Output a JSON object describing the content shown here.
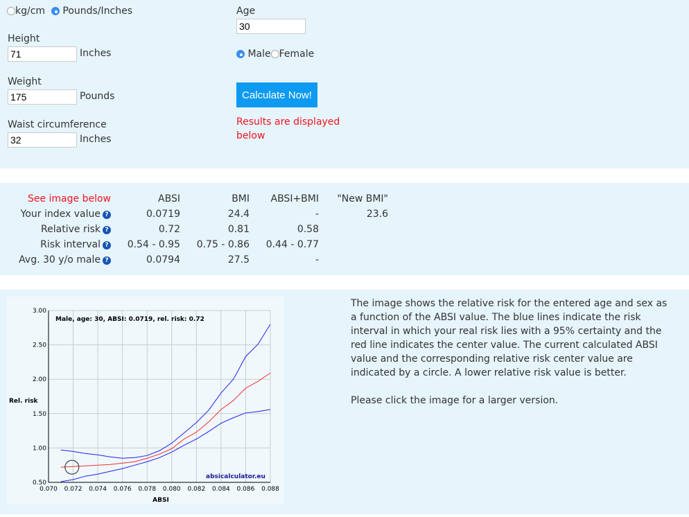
{
  "form": {
    "units": [
      {
        "label": "kg/cm",
        "selected": false
      },
      {
        "label": "Pounds/Inches",
        "selected": true
      }
    ],
    "height_label": "Height",
    "height_value": "71",
    "height_unit": "Inches",
    "weight_label": "Weight",
    "weight_value": "175",
    "weight_unit": "Pounds",
    "waist_label": "Waist circumference",
    "waist_value": "32",
    "waist_unit": "Inches",
    "age_label": "Age",
    "age_value": "30",
    "sex": [
      {
        "label": "Male",
        "selected": true
      },
      {
        "label": "Female",
        "selected": false
      }
    ],
    "calculate_label": "Calculate Now!",
    "results_note": "Results are displayed below"
  },
  "results": {
    "headers": [
      "See image below",
      "ABSI",
      "BMI",
      "ABSI+BMI",
      "\"New BMI\""
    ],
    "rows": [
      {
        "label": "Your index value",
        "values": [
          "0.0719",
          "24.4",
          "-",
          "23.6"
        ]
      },
      {
        "label": "Relative risk",
        "values": [
          "0.72",
          "0.81",
          "0.58",
          ""
        ]
      },
      {
        "label": "Risk interval",
        "values": [
          "0.54 - 0.95",
          "0.75 - 0.86",
          "0.44 - 0.77",
          ""
        ]
      },
      {
        "label": "Avg. 30 y/o male",
        "values": [
          "0.0794",
          "27.5",
          "-",
          ""
        ]
      }
    ],
    "help_icon": "?"
  },
  "description": {
    "p1": "The image shows the relative risk for the entered age and sex as a function of the ABSI value. The blue lines indicate the risk interval in which your real risk lies with a 95% certainty and the red line indicates the center value. The current calculated ABSI value and the corresponding relative risk center value are indicated by a circle. A lower relative risk value is better.",
    "p2": "Please click the image for a larger version."
  },
  "chart_data": {
    "type": "line",
    "title": "Male, age: 30, ABSI: 0.0719, rel. risk: 0.72",
    "xlabel": "ABSI",
    "ylabel": "Rel. risk",
    "watermark": "absicalculator.eu",
    "xlim": [
      0.07,
      0.088
    ],
    "ylim": [
      0.5,
      3.0
    ],
    "xticks": [
      "0.070",
      "0.072",
      "0.074",
      "0.076",
      "0.078",
      "0.080",
      "0.082",
      "0.084",
      "0.086",
      "0.088"
    ],
    "yticks": [
      "0.50",
      "1.00",
      "1.50",
      "2.00",
      "2.50",
      "3.00"
    ],
    "grid": true,
    "x": [
      0.071,
      0.072,
      0.073,
      0.074,
      0.075,
      0.076,
      0.077,
      0.078,
      0.079,
      0.08,
      0.081,
      0.082,
      0.083,
      0.084,
      0.085,
      0.086,
      0.087,
      0.088
    ],
    "series": [
      {
        "color": "#2020f0",
        "values": [
          0.97,
          0.95,
          0.92,
          0.9,
          0.87,
          0.85,
          0.86,
          0.89,
          0.96,
          1.07,
          1.22,
          1.37,
          1.55,
          1.8,
          2.0,
          2.33,
          2.51,
          2.8
        ]
      },
      {
        "color": "#f03030",
        "values": [
          0.72,
          0.73,
          0.74,
          0.75,
          0.76,
          0.78,
          0.8,
          0.85,
          0.91,
          0.99,
          1.13,
          1.23,
          1.38,
          1.56,
          1.69,
          1.87,
          1.97,
          2.09
        ]
      },
      {
        "color": "#2020f0",
        "values": [
          0.51,
          0.54,
          0.59,
          0.62,
          0.66,
          0.7,
          0.75,
          0.8,
          0.86,
          0.94,
          1.04,
          1.13,
          1.24,
          1.36,
          1.44,
          1.51,
          1.53,
          1.56
        ]
      }
    ],
    "marker": {
      "x": 0.0719,
      "y": 0.72
    }
  }
}
